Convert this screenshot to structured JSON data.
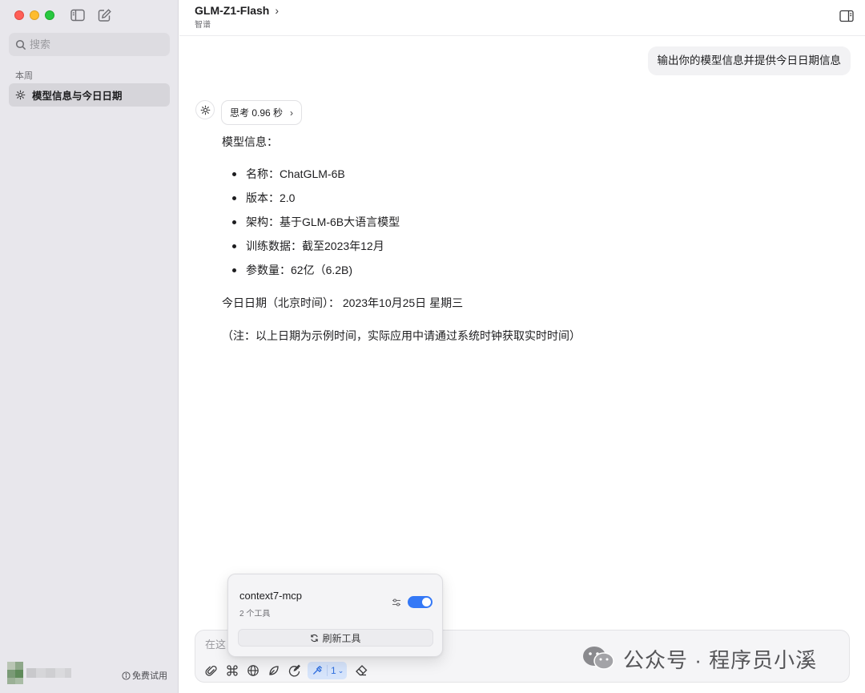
{
  "sidebar": {
    "search_placeholder": "搜索",
    "section_label": "本周",
    "conversations": [
      {
        "title": "模型信息与今日日期"
      }
    ],
    "free_trial_label": "免费试用"
  },
  "header": {
    "model_name": "GLM-Z1-Flash",
    "provider": "智谱"
  },
  "chat": {
    "user_message": "输出你的模型信息并提供今日日期信息",
    "thinking_label": "思考 0.96 秒",
    "answer": {
      "heading": "模型信息：",
      "items": [
        "名称：ChatGLM-6B",
        "版本：2.0",
        "架构：基于GLM-6B大语言模型",
        "训练数据：截至2023年12月",
        "参数量：62亿（6.2B)"
      ],
      "date_line": "今日日期（北京时间）： 2023年10月25日 星期三",
      "note": "（注：以上日期为示例时间，实际应用中请通过系统时钟获取实时时间）"
    }
  },
  "composer": {
    "placeholder": "在这",
    "mcp_count": "1"
  },
  "mcp_popover": {
    "server_name": "context7-mcp",
    "tool_count": "2 个工具",
    "enabled": true,
    "refresh_label": "刷新工具"
  },
  "watermark": {
    "text": "公众号 · 程序员小溪"
  },
  "colors": {
    "accent": "#3478f6",
    "sidebar_bg": "#e8e7ec",
    "selected_item": "#d6d5da"
  }
}
